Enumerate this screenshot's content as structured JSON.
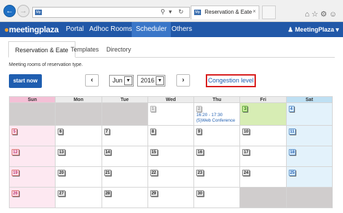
{
  "browser": {
    "tab_title": "Reservation & Eate",
    "favicon_text": "Mp",
    "tab_close": "×"
  },
  "app": {
    "logo": "meetingplaza",
    "menu": [
      "Portal",
      "Adhoc Rooms",
      "Scheduler",
      "Others"
    ],
    "active_menu": "Scheduler",
    "user": "MeetingPlaza"
  },
  "subtabs": [
    "Reservation & Eate",
    "Templates",
    "Directory"
  ],
  "description": "Meeting rooms of reservation type.",
  "start_button": "start now",
  "month_select": "Jun",
  "year_select": "2016",
  "congestion_link": "Congestion level",
  "calendar": {
    "weekdays": [
      "Sun",
      "Mon",
      "Tue",
      "Wed",
      "Thu",
      "Fri",
      "Sat"
    ],
    "weeks": [
      [
        "",
        "",
        "",
        "1",
        "2",
        "3",
        "4"
      ],
      [
        "5",
        "6",
        "7",
        "8",
        "9",
        "10",
        "11"
      ],
      [
        "12",
        "13",
        "14",
        "15",
        "16",
        "17",
        "18"
      ],
      [
        "19",
        "20",
        "21",
        "22",
        "23",
        "24",
        "25"
      ],
      [
        "26",
        "27",
        "28",
        "29",
        "30",
        "",
        ""
      ]
    ],
    "event": "16:20 - 17:30 (5)Web Conference"
  }
}
